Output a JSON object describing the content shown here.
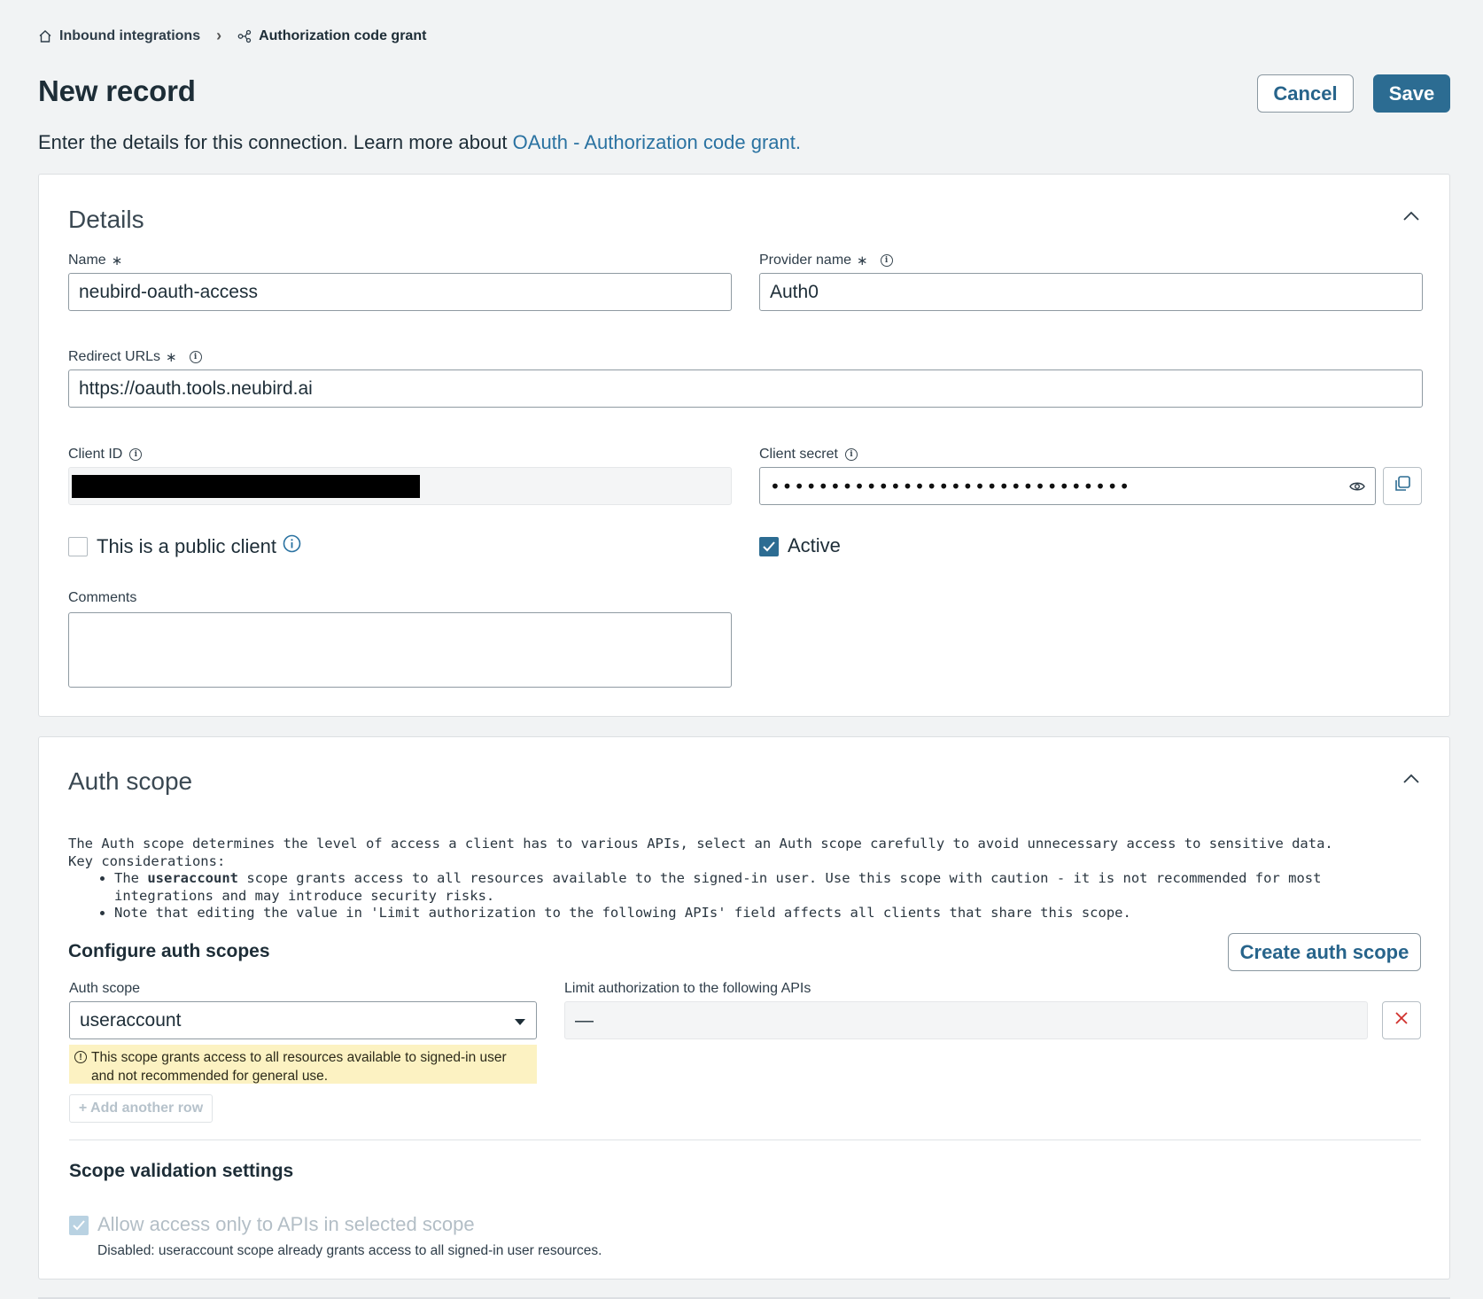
{
  "breadcrumb": {
    "home_label": "Inbound integrations",
    "current_label": "Authorization code grant"
  },
  "header": {
    "title": "New record",
    "cancel_label": "Cancel",
    "save_label": "Save"
  },
  "intro": {
    "text": "Enter the details for this connection. Learn more about ",
    "link_text": "OAuth - Authorization code grant."
  },
  "details": {
    "title": "Details",
    "name_label": "Name",
    "name_value": "neubird-oauth-access",
    "provider_label": "Provider name",
    "provider_value": "Auth0",
    "redirect_label": "Redirect URLs",
    "redirect_value": "https://oauth.tools.neubird.ai",
    "client_id_label": "Client ID",
    "client_secret_label": "Client secret",
    "client_secret_mask": "••••••••••••••••••••••••••••••",
    "public_client_label": "This is a public client",
    "public_client_checked": false,
    "active_label": "Active",
    "active_checked": true,
    "comments_label": "Comments",
    "comments_value": "",
    "required_marker": "∗"
  },
  "auth_scope": {
    "title": "Auth scope",
    "description": "The Auth scope determines the level of access a client has to various APIs, select an Auth scope carefully to avoid unnecessary access to sensitive data.",
    "key_considerations_label": "Key considerations:",
    "bullet1_prefix": "The ",
    "bullet1_bold": "useraccount",
    "bullet1_suffix": " scope grants access to all resources available to the signed-in user. Use this scope with caution - it is not recommended for most integrations and may introduce security risks.",
    "bullet2": "Note that editing the value in 'Limit authorization to the following APIs' field affects all clients that share this scope.",
    "configure_title": "Configure auth scopes",
    "create_button_label": "Create auth scope",
    "scope_label": "Auth scope",
    "scope_value": "useraccount",
    "limit_label": "Limit authorization to the following APIs",
    "limit_value": "—",
    "warning_text": "This scope grants access to all resources available to signed-in user and not recommended for general use.",
    "add_row_label": "+ Add another row"
  },
  "scope_validation": {
    "title": "Scope validation settings",
    "allow_label": "Allow access only to APIs in selected scope",
    "allow_checked": true,
    "disabled_note": "Disabled: useraccount scope already grants access to all signed-in user resources."
  },
  "colors": {
    "primary": "#2c6c92",
    "link": "#2a72a1",
    "warning_bg": "#fcf2c2",
    "danger": "#d0312d"
  }
}
